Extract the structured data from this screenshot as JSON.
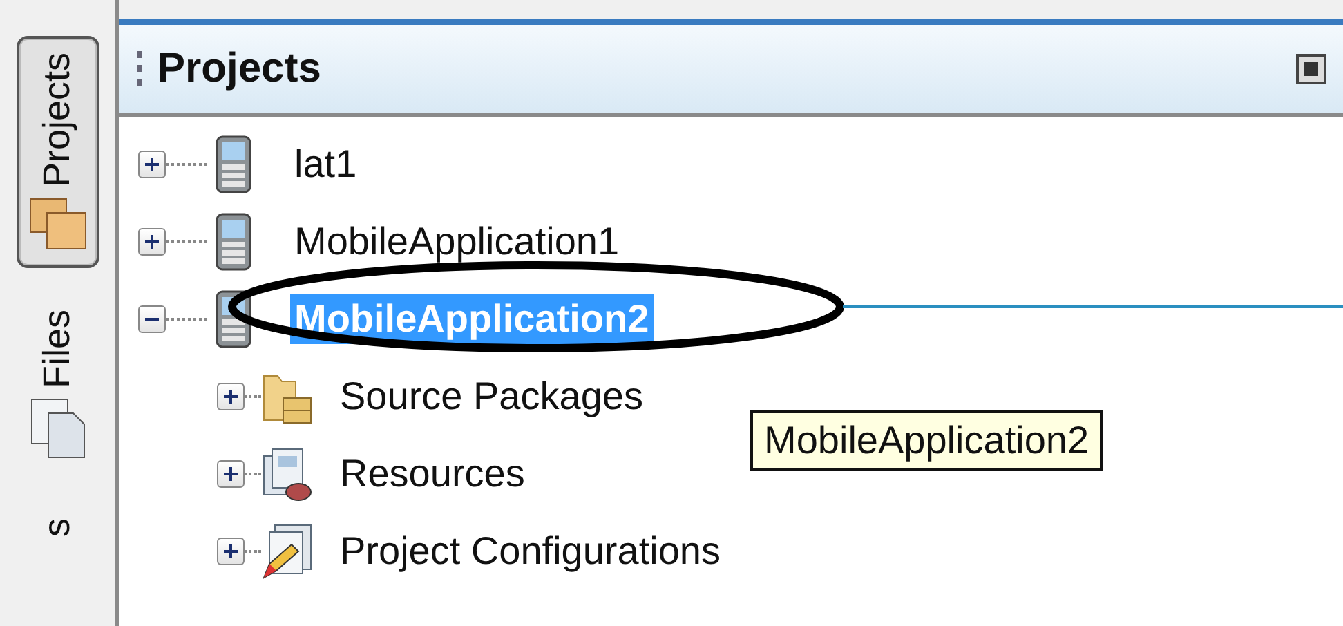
{
  "side_tabs": [
    {
      "label": "Projects",
      "kind": "projects",
      "selected": true
    },
    {
      "label": "Files",
      "kind": "files",
      "selected": false
    },
    {
      "label": "s",
      "kind": "other",
      "selected": false
    }
  ],
  "panel": {
    "title": "Projects"
  },
  "tree": [
    {
      "label": "lat1",
      "kind": "mobile",
      "expanded": false,
      "selected": false
    },
    {
      "label": "MobileApplication1",
      "kind": "mobile",
      "expanded": false,
      "selected": false
    },
    {
      "label": "MobileApplication2",
      "kind": "mobile",
      "expanded": true,
      "selected": true,
      "children": [
        {
          "label": "Source Packages",
          "kind": "sources",
          "expanded": false,
          "selected": false
        },
        {
          "label": "Resources",
          "kind": "resources",
          "expanded": false,
          "selected": false
        },
        {
          "label": "Project Configurations",
          "kind": "configurations",
          "expanded": false,
          "selected": false
        }
      ]
    }
  ],
  "tooltip": {
    "text": "MobileApplication2"
  }
}
